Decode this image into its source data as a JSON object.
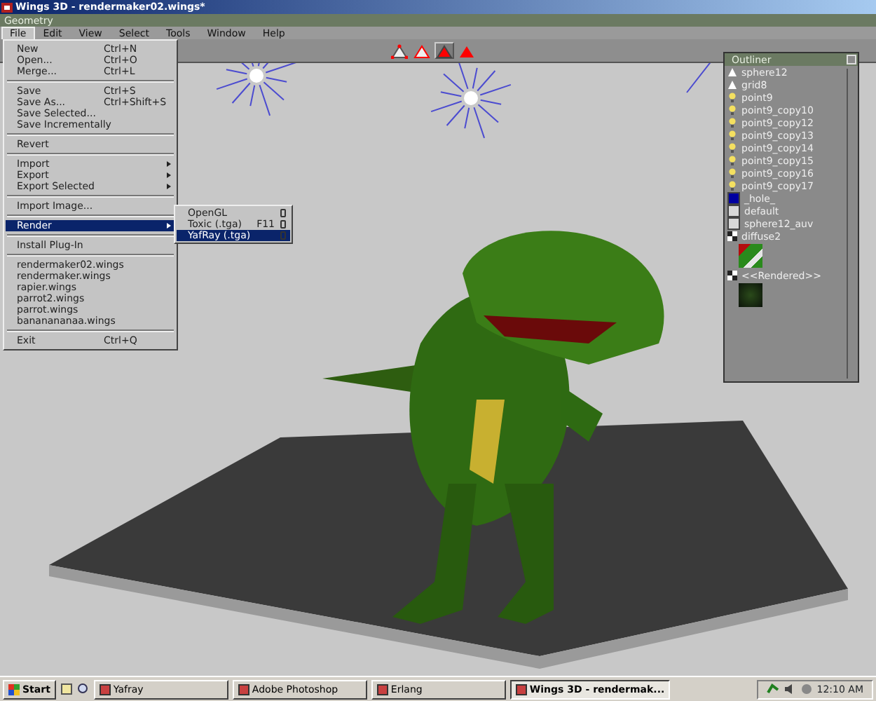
{
  "window": {
    "title": "Wings 3D - rendermaker02.wings*"
  },
  "geometry_bar": {
    "title": "Geometry"
  },
  "menu_bar": [
    {
      "label": "File",
      "selected": true
    },
    {
      "label": "Edit",
      "selected": false
    },
    {
      "label": "View",
      "selected": false
    },
    {
      "label": "Select",
      "selected": false
    },
    {
      "label": "Tools",
      "selected": false
    },
    {
      "label": "Window",
      "selected": false
    },
    {
      "label": "Help",
      "selected": false
    }
  ],
  "mode_buttons": [
    {
      "kind": "vertex",
      "selected": false
    },
    {
      "kind": "edge",
      "selected": false
    },
    {
      "kind": "face",
      "selected": true
    },
    {
      "kind": "body",
      "selected": false
    }
  ],
  "file_menu": [
    {
      "kind": "item",
      "label": "New",
      "shortcut": "Ctrl+N",
      "has_submenu": false,
      "selected": false
    },
    {
      "kind": "item",
      "label": "Open...",
      "shortcut": "Ctrl+O",
      "has_submenu": false,
      "selected": false
    },
    {
      "kind": "item",
      "label": "Merge...",
      "shortcut": "Ctrl+L",
      "has_submenu": false,
      "selected": false
    },
    {
      "kind": "separator"
    },
    {
      "kind": "item",
      "label": "Save",
      "shortcut": "Ctrl+S",
      "has_submenu": false,
      "selected": false
    },
    {
      "kind": "item",
      "label": "Save As...",
      "shortcut": "Ctrl+Shift+S",
      "has_submenu": false,
      "selected": false
    },
    {
      "kind": "item",
      "label": "Save Selected...",
      "has_submenu": false,
      "selected": false
    },
    {
      "kind": "item",
      "label": "Save Incrementally",
      "has_submenu": false,
      "selected": false
    },
    {
      "kind": "separator"
    },
    {
      "kind": "item",
      "label": "Revert",
      "has_submenu": false,
      "selected": false
    },
    {
      "kind": "separator"
    },
    {
      "kind": "item",
      "label": "Import",
      "has_submenu": true,
      "selected": false
    },
    {
      "kind": "item",
      "label": "Export",
      "has_submenu": true,
      "selected": false
    },
    {
      "kind": "item",
      "label": "Export Selected",
      "has_submenu": true,
      "selected": false
    },
    {
      "kind": "separator"
    },
    {
      "kind": "item",
      "label": "Import Image...",
      "has_submenu": false,
      "selected": false
    },
    {
      "kind": "separator"
    },
    {
      "kind": "item",
      "label": "Render",
      "has_submenu": true,
      "selected": true
    },
    {
      "kind": "separator"
    },
    {
      "kind": "item",
      "label": "Install Plug-In",
      "has_submenu": false,
      "selected": false
    },
    {
      "kind": "separator"
    },
    {
      "kind": "item",
      "label": "rendermaker02.wings",
      "has_submenu": false,
      "selected": false
    },
    {
      "kind": "item",
      "label": "rendermaker.wings",
      "has_submenu": false,
      "selected": false
    },
    {
      "kind": "item",
      "label": "rapier.wings",
      "has_submenu": false,
      "selected": false
    },
    {
      "kind": "item",
      "label": "parrot2.wings",
      "has_submenu": false,
      "selected": false
    },
    {
      "kind": "item",
      "label": "parrot.wings",
      "has_submenu": false,
      "selected": false
    },
    {
      "kind": "item",
      "label": "bananananaa.wings",
      "has_submenu": false,
      "selected": false
    },
    {
      "kind": "separator"
    },
    {
      "kind": "item",
      "label": "Exit",
      "shortcut": "Ctrl+Q",
      "has_submenu": false,
      "selected": false
    }
  ],
  "render_submenu": [
    {
      "label": "OpenGL",
      "has_options": true,
      "selected": false
    },
    {
      "label": "Toxic (.tga)",
      "shortcut": "F11",
      "has_options": true,
      "selected": false
    },
    {
      "label": "YafRay (.tga)",
      "has_options": true,
      "selected": true
    }
  ],
  "outliner": {
    "title": "Outliner",
    "items": [
      {
        "kind": "object",
        "label": "sphere12"
      },
      {
        "kind": "object",
        "label": "grid8"
      },
      {
        "kind": "light",
        "label": "point9"
      },
      {
        "kind": "light",
        "label": "point9_copy10"
      },
      {
        "kind": "light",
        "label": "point9_copy12"
      },
      {
        "kind": "light",
        "label": "point9_copy13"
      },
      {
        "kind": "light",
        "label": "point9_copy14"
      },
      {
        "kind": "light",
        "label": "point9_copy15"
      },
      {
        "kind": "light",
        "label": "point9_copy16"
      },
      {
        "kind": "light",
        "label": "point9_copy17"
      },
      {
        "kind": "material",
        "label": "_hole_",
        "color": "#0000a0"
      },
      {
        "kind": "material",
        "label": "default",
        "color": "#d8d8d8"
      },
      {
        "kind": "material",
        "label": "sphere12_auv",
        "color": "#d8d8d8"
      },
      {
        "kind": "texture",
        "label": "diffuse2"
      },
      {
        "kind": "render",
        "label": "<<Rendered>>"
      }
    ]
  },
  "taskbar": {
    "start": "Start",
    "tasks": [
      {
        "label": "Yafray",
        "selected": false
      },
      {
        "label": "Adobe Photoshop",
        "selected": false
      },
      {
        "label": "Erlang",
        "selected": false
      },
      {
        "label": "Wings 3D - rendermak...",
        "selected": true
      }
    ],
    "clock": "12:10 AM"
  }
}
